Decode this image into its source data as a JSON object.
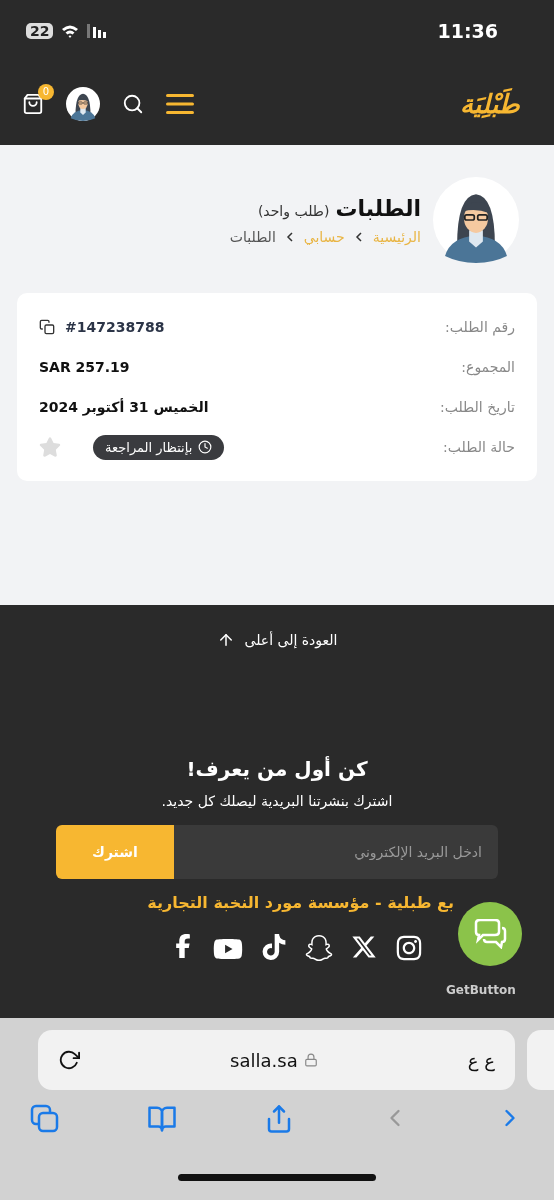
{
  "status_bar": {
    "battery": "22",
    "time": "11:36"
  },
  "header": {
    "logo": "طَبْلِيَة",
    "cart_count": "0"
  },
  "profile": {
    "title": "الطلبات",
    "count": "(طلب واحد)",
    "breadcrumb": [
      {
        "label": "الرئيسية",
        "kind": "link"
      },
      {
        "label": "حسابي",
        "kind": "link"
      },
      {
        "label": "الطلبات",
        "kind": "current"
      }
    ]
  },
  "order": {
    "rows": [
      {
        "label": "رقم الطلب:",
        "value": "#147238788",
        "kind": "id"
      },
      {
        "label": "المجموع:",
        "value": "SAR 257.19",
        "kind": "text"
      },
      {
        "label": "تاريخ الطلب:",
        "value": "الخميس 31 أكتوبر 2024",
        "kind": "text"
      },
      {
        "label": "حالة الطلب:",
        "value": "بإنتظار المراجعة",
        "kind": "status"
      }
    ]
  },
  "footer": {
    "back_to_top": "العودة إلى أعلى",
    "newsletter_title": "كن أول من يعرف!",
    "newsletter_text": "اشترك بنشرتنا البريدية ليصلك كل جديد.",
    "email": {
      "placeholder": "ادخل البريد الإلكتروني"
    },
    "subscribe_button": "اشترك",
    "copyright": "بع طبلية - مؤسسة مورد النخبة التجارية",
    "socials": [
      {
        "kind": "instagram"
      },
      {
        "kind": "x"
      },
      {
        "kind": "snapchat"
      },
      {
        "kind": "tiktok"
      },
      {
        "kind": "youtube"
      },
      {
        "kind": "facebook"
      }
    ]
  },
  "chat": {
    "label": "GetButton"
  },
  "browser": {
    "text_size": "ع ع",
    "url": "salla.sa",
    "nav": [
      {
        "kind": "back",
        "disabled": true
      },
      {
        "kind": "forward",
        "disabled": false
      }
    ]
  }
}
